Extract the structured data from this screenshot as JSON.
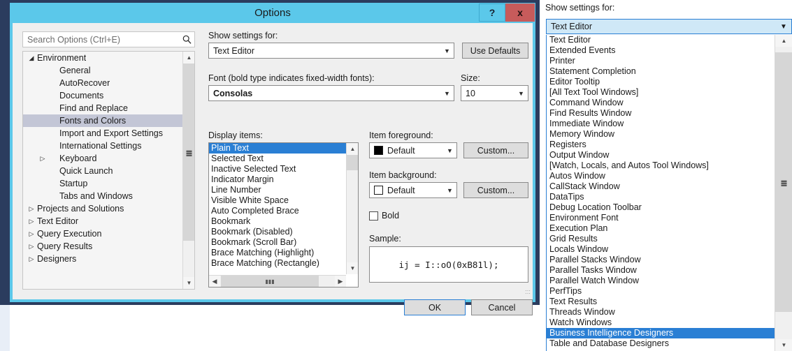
{
  "dialog": {
    "title": "Options",
    "titlebar": {
      "help_label": "?",
      "close_label": "x"
    },
    "search": {
      "placeholder": "Search Options (Ctrl+E)",
      "value": "",
      "icon": "search-icon"
    },
    "tree": [
      {
        "label": "Environment",
        "level": 1,
        "twisty": "expanded",
        "selected": false
      },
      {
        "label": "General",
        "level": 2,
        "twisty": "none",
        "selected": false
      },
      {
        "label": "AutoRecover",
        "level": 2,
        "twisty": "none",
        "selected": false
      },
      {
        "label": "Documents",
        "level": 2,
        "twisty": "none",
        "selected": false
      },
      {
        "label": "Find and Replace",
        "level": 2,
        "twisty": "none",
        "selected": false
      },
      {
        "label": "Fonts and Colors",
        "level": 2,
        "twisty": "none",
        "selected": true
      },
      {
        "label": "Import and Export Settings",
        "level": 2,
        "twisty": "none",
        "selected": false
      },
      {
        "label": "International Settings",
        "level": 2,
        "twisty": "none",
        "selected": false
      },
      {
        "label": "Keyboard",
        "level": 2,
        "twisty": "collapsed",
        "selected": false
      },
      {
        "label": "Quick Launch",
        "level": 2,
        "twisty": "none",
        "selected": false
      },
      {
        "label": "Startup",
        "level": 2,
        "twisty": "none",
        "selected": false
      },
      {
        "label": "Tabs and Windows",
        "level": 2,
        "twisty": "none",
        "selected": false
      },
      {
        "label": "Projects and Solutions",
        "level": 1,
        "twisty": "collapsed",
        "selected": false
      },
      {
        "label": "Text Editor",
        "level": 1,
        "twisty": "collapsed",
        "selected": false
      },
      {
        "label": "Query Execution",
        "level": 1,
        "twisty": "collapsed",
        "selected": false
      },
      {
        "label": "Query Results",
        "level": 1,
        "twisty": "collapsed",
        "selected": false
      },
      {
        "label": "Designers",
        "level": 1,
        "twisty": "collapsed",
        "selected": false
      }
    ],
    "show_settings_for": {
      "label": "Show settings for:",
      "value": "Text Editor"
    },
    "use_defaults_label": "Use Defaults",
    "font": {
      "label": "Font (bold type indicates fixed-width fonts):",
      "value": "Consolas"
    },
    "size": {
      "label": "Size:",
      "value": "10"
    },
    "display_items": {
      "label": "Display items:",
      "items": [
        "Plain Text",
        "Selected Text",
        "Inactive Selected Text",
        "Indicator Margin",
        "Line Number",
        "Visible White Space",
        "Auto Completed Brace",
        "Bookmark",
        "Bookmark (Disabled)",
        "Bookmark (Scroll Bar)",
        "Brace Matching (Highlight)",
        "Brace Matching (Rectangle)"
      ],
      "selected_index": 0
    },
    "item_foreground": {
      "label": "Item foreground:",
      "value": "Default",
      "swatch_color": "#000000",
      "custom_label": "Custom..."
    },
    "item_background": {
      "label": "Item background:",
      "value": "Default",
      "swatch_color": "#ffffff",
      "custom_label": "Custom..."
    },
    "bold": {
      "label": "Bold",
      "checked": false
    },
    "sample": {
      "label": "Sample:",
      "text": "ij = I::oO(0xB81l);"
    },
    "ok_label": "OK",
    "cancel_label": "Cancel"
  },
  "right_panel": {
    "label": "Show settings for:",
    "combo_value": "Text Editor",
    "items": [
      "Text Editor",
      "Extended Events",
      "Printer",
      "Statement Completion",
      "Editor Tooltip",
      "[All Text Tool Windows]",
      "Command Window",
      "Find Results Window",
      "Immediate Window",
      "Memory Window",
      "Registers",
      "Output Window",
      "[Watch, Locals, and Autos Tool Windows]",
      "Autos Window",
      "CallStack Window",
      "DataTips",
      "Debug Location Toolbar",
      "Environment Font",
      "Execution Plan",
      "Grid Results",
      "Locals Window",
      "Parallel Stacks Window",
      "Parallel Tasks Window",
      "Parallel Watch Window",
      "PerfTips",
      "Text Results",
      "Threads Window",
      "Watch Windows",
      "Business Intelligence Designers",
      "Table and Database Designers"
    ],
    "selected_item": "Business Intelligence Designers"
  },
  "colors": {
    "window_chrome": "#5bc8ea",
    "window_frame": "#2b3c5e",
    "selection_blue": "#2a7fd4",
    "tree_selection": "#c3c6d6",
    "close_button": "#c75b5b"
  }
}
